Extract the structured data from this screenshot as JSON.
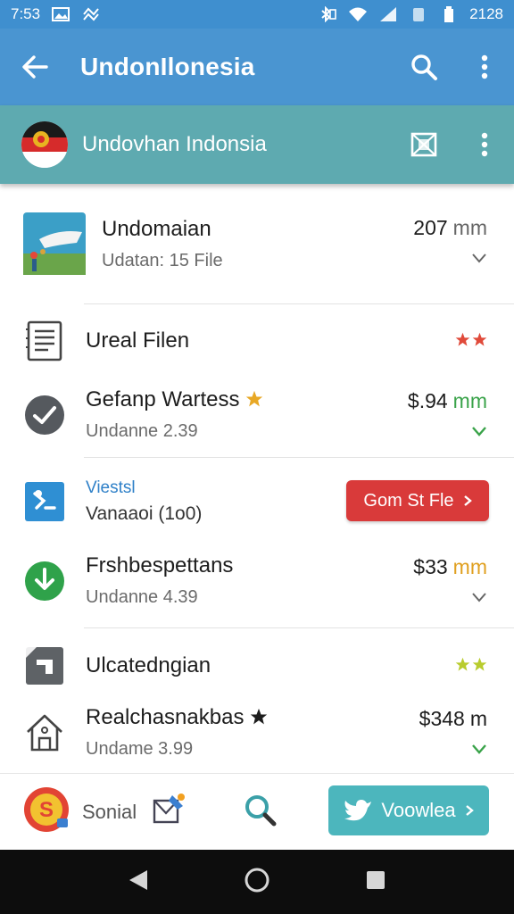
{
  "status_bar": {
    "time": "7:53",
    "battery_text": "2128"
  },
  "app_bar": {
    "title": "UndonIlonesia"
  },
  "sub_bar": {
    "title": "Undovhan Indonsia"
  },
  "items": [
    {
      "primary": "Undomaian",
      "secondary": "Udatan: 15 File",
      "value": "207",
      "unit": "mm",
      "icon": "travel-thumbnail-icon"
    },
    {
      "primary": "Ureal Filen",
      "icon": "document-icon",
      "rating": 2,
      "star_color": "#e04a3a"
    },
    {
      "primary": "Gefanp Wartess",
      "secondary": "Undanne 2.39",
      "value": "$.94",
      "unit": "mm",
      "icon": "check-circle-icon",
      "unit_color": "#3aa34a"
    },
    {
      "primary": "Viestsl",
      "secondary": "Vanaaoi (1o0)",
      "button": "Gom St Fle",
      "icon": "chart-square-icon"
    },
    {
      "primary": "Frshbespettans",
      "secondary": "Undanne 4.39",
      "value": "$33",
      "unit": "mm",
      "icon": "download-circle-icon",
      "unit_color": "#e0a020"
    },
    {
      "primary": "Ulcatedngian",
      "icon": "folder-square-icon",
      "rating": 2,
      "star_color": "#b9cc2e"
    },
    {
      "primary": "Realchasnakbas",
      "secondary": "Undame 3.99",
      "value": "$348",
      "unit": "m",
      "icon": "house-icon"
    }
  ],
  "bottom_bar": {
    "social_label": "Sonial",
    "cta_label": "Voowlea"
  },
  "colors": {
    "app_bar": "#4a95d1",
    "sub_bar": "#5eaab0",
    "accent_red": "#d93a3a",
    "accent_teal": "#4cb6bd"
  }
}
